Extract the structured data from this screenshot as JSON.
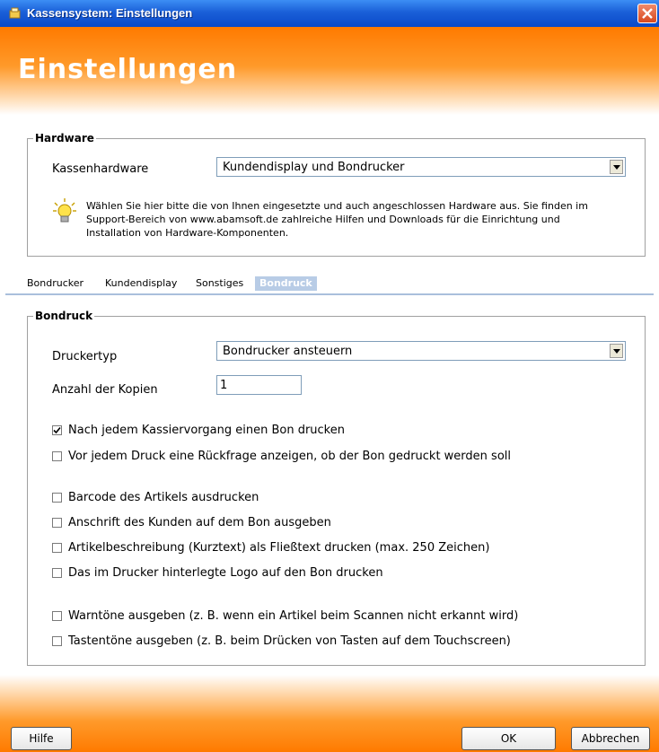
{
  "window": {
    "title": "Kassensystem: Einstellungen"
  },
  "banner": {
    "heading": "Einstellungen"
  },
  "hardware": {
    "group_label": "Hardware",
    "label": "Kassenhardware",
    "selected": "Kundendisplay und Bondrucker",
    "hint_lines": [
      "Wählen Sie hier bitte die von Ihnen eingesetzte und auch angeschlossen Hardware aus. Sie finden im",
      "Support-Bereich von www.abamsoft.de zahlreiche Hilfen und Downloads für die Einrichtung und",
      "Installation von Hardware-Komponenten."
    ]
  },
  "tabs": [
    {
      "label": "Bondrucker",
      "active": false
    },
    {
      "label": "Kundendisplay",
      "active": false
    },
    {
      "label": "Sonstiges",
      "active": false
    },
    {
      "label": "Bondruck",
      "active": true
    }
  ],
  "bondruck": {
    "group_label": "Bondruck",
    "druckertyp_label": "Druckertyp",
    "druckertyp_value": "Bondrucker ansteuern",
    "kopien_label": "Anzahl der Kopien",
    "kopien_value": "1",
    "options": [
      {
        "label": "Nach jedem Kassiervorgang einen Bon drucken",
        "checked": true
      },
      {
        "label": "Vor jedem Druck eine Rückfrage anzeigen, ob der Bon gedruckt werden soll",
        "checked": false
      },
      {
        "label": "Barcode des Artikels ausdrucken",
        "checked": false
      },
      {
        "label": "Anschrift des Kunden auf dem Bon ausgeben",
        "checked": false
      },
      {
        "label": "Artikelbeschreibung (Kurztext) als Fließtext drucken (max. 250 Zeichen)",
        "checked": false
      },
      {
        "label": "Das im Drucker hinterlegte Logo auf den Bon drucken",
        "checked": false
      },
      {
        "label": "Warntöne ausgeben (z. B. wenn ein Artikel beim Scannen nicht erkannt wird)",
        "checked": false
      },
      {
        "label": "Tastentöne ausgeben (z. B. beim Drücken von Tasten auf dem Touchscreen)",
        "checked": false
      }
    ]
  },
  "footer": {
    "help_label": "Hilfe",
    "ok_label": "OK",
    "cancel_label": "Abbrechen"
  }
}
